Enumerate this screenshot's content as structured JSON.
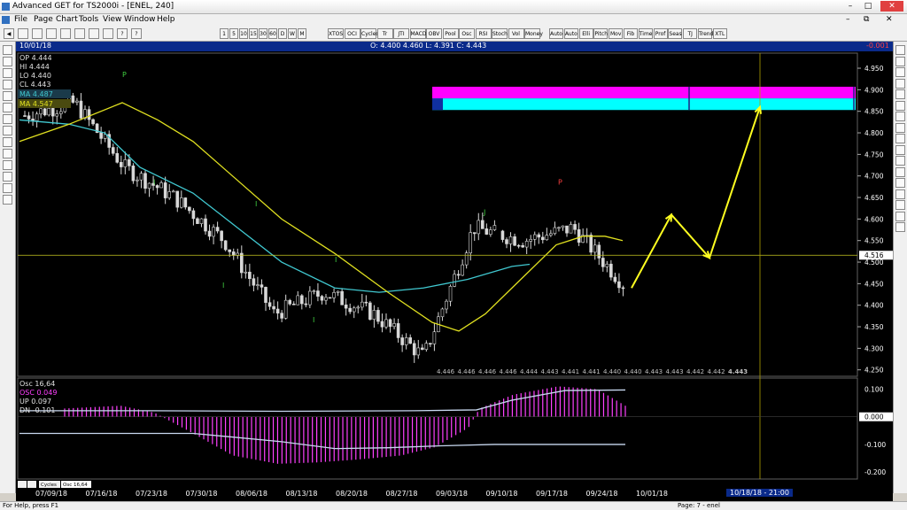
{
  "window": {
    "title": "Advanced GET for TS2000i - [ENEL, 240]",
    "close_color": "#e04040"
  },
  "menu": [
    "File",
    "Page",
    "Chart",
    "Tools",
    "View",
    "Window",
    "Help"
  ],
  "toolbar": {
    "periods": [
      "1",
      "5",
      "10",
      "15",
      "30",
      "60",
      "D",
      "W",
      "M"
    ],
    "studies": [
      "XTOS",
      "OCI",
      "Cycles",
      "Tr",
      "JTI",
      "MACD",
      "OBV",
      "Pool",
      "Osc",
      "RSI",
      "Stoch",
      "Vol",
      "Money"
    ],
    "tools": [
      "Auto",
      "Auto",
      "Elli",
      "Pitch",
      "Mov",
      "Fib",
      "Time",
      "Prof",
      "Seas",
      "TJ",
      "Trend",
      "XTL"
    ]
  },
  "infobar": {
    "date": "10/01/18",
    "ohlc": "O: 4.400     4.460   L: 4.391   C: 4.443",
    "change": "-0.001",
    "change_color": "#ff4040"
  },
  "legend": {
    "op": "OP  4.444",
    "hi": "HI  4.444",
    "lo": "LO  4.440",
    "cl": "CL  4.443",
    "ma1": "MA 4.487",
    "ma2": "MA 4.547",
    "ma1_color": "#40c8d0",
    "ma2_color": "#e0e020"
  },
  "price_axis": [
    "4.950",
    "4.900",
    "4.850",
    "4.800",
    "4.750",
    "4.700",
    "4.650",
    "4.600",
    "4.550",
    "4.500",
    "4.450",
    "4.400",
    "4.350",
    "4.300",
    "4.250"
  ],
  "price_marker": "4.516",
  "bottom_values": [
    "4.446",
    "4.446",
    "4.446",
    "4.446",
    "4.444",
    "4.443",
    "4.441",
    "4.441",
    "4.440",
    "4.440",
    "4.443",
    "4.443",
    "4.442",
    "4.442",
    "4.443"
  ],
  "osc_legend": {
    "title": "Osc 16,64",
    "osc": "OSC 0.049",
    "up": "UP  0.097",
    "dn": "DN  -0.101",
    "osc_color": "#ff40ff"
  },
  "osc_axis": [
    "0.100",
    "0.000",
    "-0.100",
    "-0.200"
  ],
  "date_axis": [
    "07/09/18",
    "07/16/18",
    "07/23/18",
    "07/30/18",
    "08/06/18",
    "08/13/18",
    "08/20/18",
    "08/27/18",
    "09/03/18",
    "09/10/18",
    "09/17/18",
    "09/24/18",
    "10/01/18"
  ],
  "cursor_date": "10/18/18 - 21:00",
  "tabs": [
    "Cycles",
    "Osc 16,64"
  ],
  "status": {
    "left": "For Help, press F1",
    "right": "Page: 7 - enel"
  },
  "colors": {
    "magenta": "#ff00ff",
    "cyan": "#00ffff",
    "yellow_line": "#ffff20",
    "candle": "#d8d8d8"
  },
  "chart_data": {
    "type": "candlestick",
    "close_series_weekly": [
      4.84,
      4.87,
      4.72,
      4.65,
      4.55,
      4.38,
      4.43,
      4.38,
      4.28,
      4.58,
      4.55,
      4.58,
      4.45
    ],
    "projection": [
      4.44,
      4.61,
      4.51,
      4.86
    ]
  }
}
